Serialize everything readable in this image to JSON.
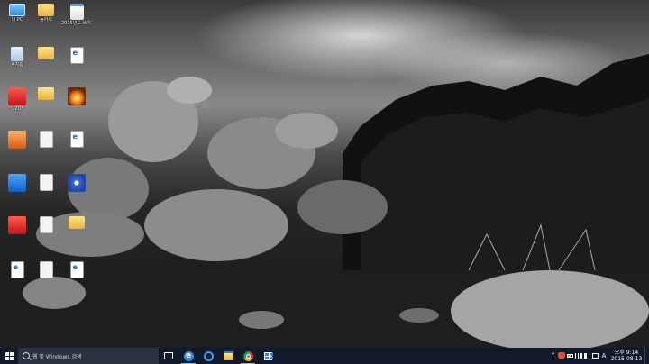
{
  "desktop": {
    "icons": [
      {
        "label": "내 PC",
        "glyph": "g-pc",
        "icon_name": "this-pc-icon"
      },
      {
        "label": "동아시",
        "glyph": "g-folder",
        "icon_name": "folder-icon"
      },
      {
        "label": "2015년도 쓰기과제 바",
        "glyph": "g-notepad",
        "icon_name": "document-icon"
      },
      {
        "label": "휴지통",
        "glyph": "g-bin",
        "icon_name": "recycle-bin-icon"
      },
      {
        "label": "",
        "glyph": "g-folder",
        "icon_name": "folder-icon"
      },
      {
        "label": "",
        "glyph": "g-pdf",
        "icon_name": "pdf-icon"
      },
      {
        "label": "알PDF",
        "glyph": "g-red",
        "icon_name": "app-icon"
      },
      {
        "label": "",
        "glyph": "g-folder",
        "icon_name": "folder-icon"
      },
      {
        "label": "",
        "glyph": "g-flame",
        "icon_name": "media-app-icon"
      },
      {
        "label": "",
        "glyph": "g-orange",
        "icon_name": "app-icon"
      },
      {
        "label": "",
        "glyph": "g-doc",
        "icon_name": "document-icon"
      },
      {
        "label": "",
        "glyph": "g-pdf",
        "icon_name": "pdf-icon"
      },
      {
        "label": "",
        "glyph": "g-blue",
        "icon_name": "app-icon"
      },
      {
        "label": "",
        "glyph": "g-doc",
        "icon_name": "document-icon"
      },
      {
        "label": "",
        "glyph": "g-disc",
        "icon_name": "disc-app-icon"
      },
      {
        "label": "",
        "glyph": "g-red",
        "icon_name": "app-icon"
      },
      {
        "label": "",
        "glyph": "g-doc",
        "icon_name": "document-icon"
      },
      {
        "label": "",
        "glyph": "g-folder",
        "icon_name": "folder-icon"
      },
      {
        "label": "",
        "glyph": "g-pdf",
        "icon_name": "pdf-icon"
      },
      {
        "label": "",
        "glyph": "g-doc",
        "icon_name": "document-icon"
      },
      {
        "label": "",
        "glyph": "g-pdf",
        "icon_name": "pdf-icon"
      }
    ]
  },
  "taskbar": {
    "search_placeholder": "웹 및 Windows 검색",
    "pinned": [
      {
        "name": "task-view-button",
        "icon": "i-taskview",
        "active": false
      },
      {
        "name": "edge-button",
        "icon": "i-edge",
        "active": true
      },
      {
        "name": "internet-explorer-button",
        "icon": "i-ie",
        "active": false
      },
      {
        "name": "file-explorer-button",
        "icon": "i-explorer",
        "active": false
      },
      {
        "name": "chrome-button",
        "icon": "i-chrome",
        "active": true
      },
      {
        "name": "store-button",
        "icon": "i-store",
        "active": false
      }
    ],
    "tray": {
      "ime": "A",
      "time": "오후 9:14",
      "date": "2015-08-13"
    }
  }
}
